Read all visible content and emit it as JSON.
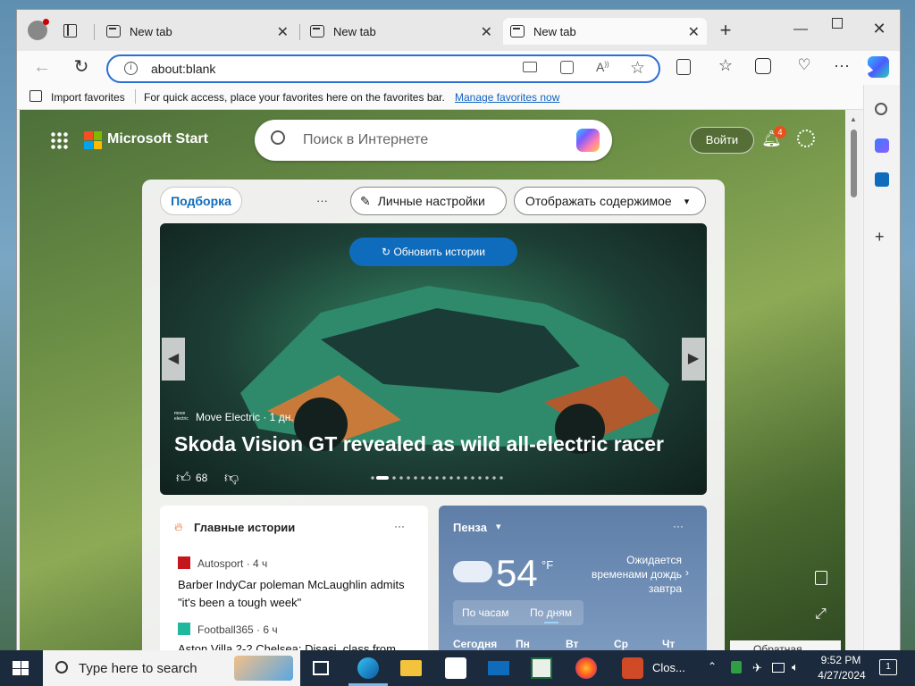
{
  "browser": {
    "tabs": [
      {
        "label": "New tab"
      },
      {
        "label": "New tab"
      },
      {
        "label": "New tab"
      }
    ],
    "address": "about:blank",
    "favorites": {
      "import_label": "Import favorites",
      "hint": "For quick access, place your favorites here on the favorites bar.",
      "manage_link": "Manage favorites now"
    }
  },
  "start": {
    "brand": "Microsoft Start",
    "search_placeholder": "Поиск в Интернете",
    "signin": "Войти",
    "notifications": "4",
    "tabs": {
      "featured": "Подборка",
      "more": "···",
      "personalize": "Личные настройки",
      "display": "Отображать содержимое"
    },
    "hero": {
      "refresh": "Обновить истории",
      "source": "Move Electric · 1 дн.",
      "source_logo": "move electric",
      "headline": "Skoda Vision GT revealed as wild all-electric racer",
      "likes": "68"
    },
    "top_stories": {
      "title": "Главные истории",
      "more": "···",
      "items": [
        {
          "source": "Autosport · 4 ч",
          "title": "Barber IndyCar poleman McLaughlin admits \"it's been a tough week\""
        },
        {
          "source": "Football365 · 6 ч",
          "title": "Aston Villa 2-2 Chelsea: Disasi, class from"
        }
      ]
    },
    "weather": {
      "city": "Пенза",
      "temp": "54",
      "unit": "°F",
      "alert": "Ожидается временами дождь завтра",
      "tab_hourly": "По часам",
      "tab_daily": "По дням",
      "days": [
        "Сегодня",
        "Пн",
        "Вт",
        "Ср",
        "Чт"
      ],
      "more": "···"
    },
    "feedback": "Обратная"
  },
  "taskbar": {
    "search_placeholder": "Type here to search",
    "app_label": "Clos...",
    "time": "9:52 PM",
    "date": "4/27/2024",
    "notif": "1"
  },
  "colors": {
    "accent": "#0f6cbd",
    "addr_border": "#2b6fd6"
  }
}
